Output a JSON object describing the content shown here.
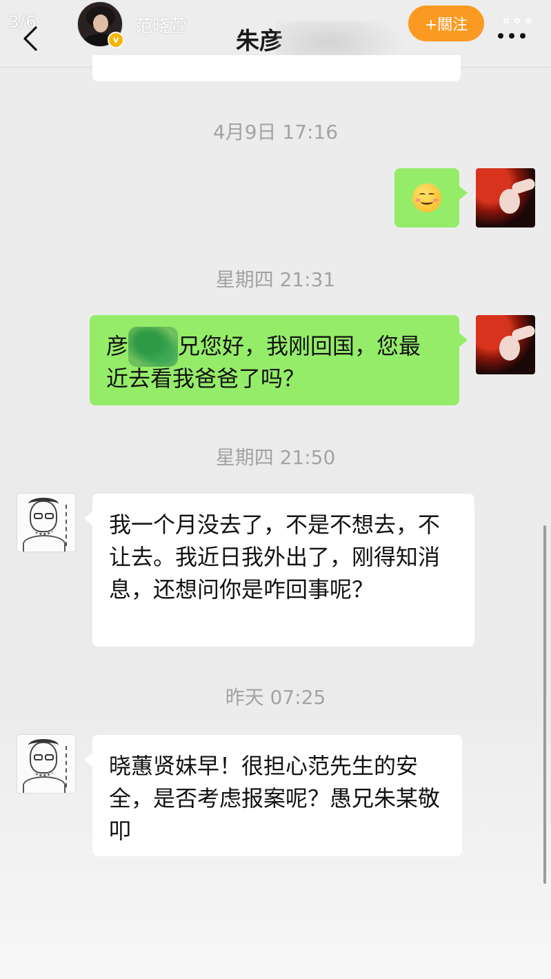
{
  "header": {
    "page_counter": "3/6",
    "back_icon": "back-arrow-icon",
    "poster_name": "范晓萱",
    "verified_badge": "v",
    "chat_title": "朱彦",
    "follow_label": "+關注",
    "more_icon": "more-dots-icon"
  },
  "colors": {
    "sent_bubble": "#95ec69",
    "received_bubble": "#ffffff",
    "follow_button": "#fb9a22",
    "timestamp_text": "#a3a3a3"
  },
  "messages": [
    {
      "timestamp": "4月9日 17:16",
      "direction": "sent",
      "content": "emoji",
      "emoji": "smiling-face-icon"
    },
    {
      "timestamp": "星期四 21:31",
      "direction": "sent",
      "text_prefix": "彦",
      "text_suffix": "兄您好，我刚回国，您最近去看我爸爸了吗？"
    },
    {
      "timestamp": "星期四 21:50",
      "direction": "received",
      "text": "我一个月没去了，不是不想去，不让去。我近日我外出了，刚得知消息，还想问你是咋回事呢？"
    },
    {
      "timestamp": "昨天 07:25",
      "direction": "received",
      "text": "晓蕙贤妹早！很担心范先生的安全，是否考虑报案呢？愚兄朱某敬叩"
    }
  ]
}
